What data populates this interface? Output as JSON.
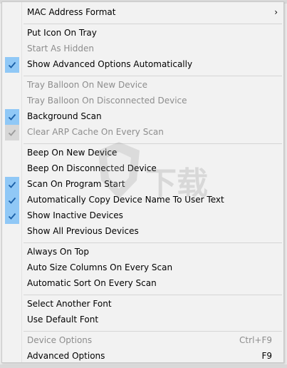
{
  "menu": {
    "items": [
      {
        "label": "MAC Address Format",
        "submenu": true
      },
      {
        "label": "Put Icon On Tray"
      },
      {
        "label": "Start As Hidden",
        "disabled": true
      },
      {
        "label": "Show Advanced Options Automatically",
        "checked": true
      },
      {
        "label": "Tray Balloon On New Device",
        "disabled": true
      },
      {
        "label": "Tray Balloon On Disconnected Device",
        "disabled": true
      },
      {
        "label": "Background Scan",
        "checked": true
      },
      {
        "label": "Clear ARP Cache On Every Scan",
        "disabled": true,
        "checked": true
      },
      {
        "label": "Beep On New Device"
      },
      {
        "label": "Beep On Disconnected Device"
      },
      {
        "label": "Scan On Program Start",
        "checked": true
      },
      {
        "label": "Automatically Copy Device Name To User Text",
        "checked": true
      },
      {
        "label": "Show Inactive Devices",
        "checked": true
      },
      {
        "label": "Show All Previous Devices"
      },
      {
        "label": "Always On Top"
      },
      {
        "label": "Auto Size Columns On Every Scan"
      },
      {
        "label": "Automatic Sort On Every Scan"
      },
      {
        "label": "Select Another Font"
      },
      {
        "label": "Use Default Font"
      },
      {
        "label": "Device Options",
        "shortcut": "Ctrl+F9",
        "disabled": true
      },
      {
        "label": "Advanced Options",
        "shortcut": "F9"
      }
    ],
    "submenu_arrow": "›"
  },
  "watermark": {
    "text": "下载"
  },
  "colors": {
    "check_bg": "#90c8f6",
    "check_bg_disabled": "#d7d7d7",
    "check_mark": "#1a5fa8",
    "disabled_text": "#8d8d8d",
    "menu_bg": "#f2f2f2"
  }
}
